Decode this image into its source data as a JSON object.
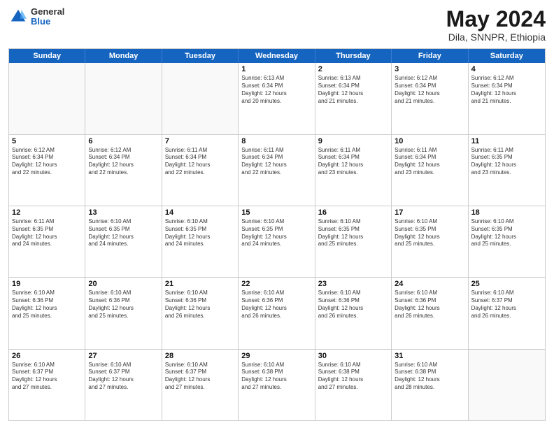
{
  "header": {
    "logo_line1": "General",
    "logo_line2": "Blue",
    "title": "May 2024",
    "subtitle": "Dila, SNNPR, Ethiopia"
  },
  "days_of_week": [
    "Sunday",
    "Monday",
    "Tuesday",
    "Wednesday",
    "Thursday",
    "Friday",
    "Saturday"
  ],
  "weeks": [
    [
      {
        "day": "",
        "info": "",
        "empty": true
      },
      {
        "day": "",
        "info": "",
        "empty": true
      },
      {
        "day": "",
        "info": "",
        "empty": true
      },
      {
        "day": "1",
        "info": "Sunrise: 6:13 AM\nSunset: 6:34 PM\nDaylight: 12 hours\nand 20 minutes.",
        "empty": false
      },
      {
        "day": "2",
        "info": "Sunrise: 6:13 AM\nSunset: 6:34 PM\nDaylight: 12 hours\nand 21 minutes.",
        "empty": false
      },
      {
        "day": "3",
        "info": "Sunrise: 6:12 AM\nSunset: 6:34 PM\nDaylight: 12 hours\nand 21 minutes.",
        "empty": false
      },
      {
        "day": "4",
        "info": "Sunrise: 6:12 AM\nSunset: 6:34 PM\nDaylight: 12 hours\nand 21 minutes.",
        "empty": false
      }
    ],
    [
      {
        "day": "5",
        "info": "Sunrise: 6:12 AM\nSunset: 6:34 PM\nDaylight: 12 hours\nand 22 minutes.",
        "empty": false
      },
      {
        "day": "6",
        "info": "Sunrise: 6:12 AM\nSunset: 6:34 PM\nDaylight: 12 hours\nand 22 minutes.",
        "empty": false
      },
      {
        "day": "7",
        "info": "Sunrise: 6:11 AM\nSunset: 6:34 PM\nDaylight: 12 hours\nand 22 minutes.",
        "empty": false
      },
      {
        "day": "8",
        "info": "Sunrise: 6:11 AM\nSunset: 6:34 PM\nDaylight: 12 hours\nand 22 minutes.",
        "empty": false
      },
      {
        "day": "9",
        "info": "Sunrise: 6:11 AM\nSunset: 6:34 PM\nDaylight: 12 hours\nand 23 minutes.",
        "empty": false
      },
      {
        "day": "10",
        "info": "Sunrise: 6:11 AM\nSunset: 6:34 PM\nDaylight: 12 hours\nand 23 minutes.",
        "empty": false
      },
      {
        "day": "11",
        "info": "Sunrise: 6:11 AM\nSunset: 6:35 PM\nDaylight: 12 hours\nand 23 minutes.",
        "empty": false
      }
    ],
    [
      {
        "day": "12",
        "info": "Sunrise: 6:11 AM\nSunset: 6:35 PM\nDaylight: 12 hours\nand 24 minutes.",
        "empty": false
      },
      {
        "day": "13",
        "info": "Sunrise: 6:10 AM\nSunset: 6:35 PM\nDaylight: 12 hours\nand 24 minutes.",
        "empty": false
      },
      {
        "day": "14",
        "info": "Sunrise: 6:10 AM\nSunset: 6:35 PM\nDaylight: 12 hours\nand 24 minutes.",
        "empty": false
      },
      {
        "day": "15",
        "info": "Sunrise: 6:10 AM\nSunset: 6:35 PM\nDaylight: 12 hours\nand 24 minutes.",
        "empty": false
      },
      {
        "day": "16",
        "info": "Sunrise: 6:10 AM\nSunset: 6:35 PM\nDaylight: 12 hours\nand 25 minutes.",
        "empty": false
      },
      {
        "day": "17",
        "info": "Sunrise: 6:10 AM\nSunset: 6:35 PM\nDaylight: 12 hours\nand 25 minutes.",
        "empty": false
      },
      {
        "day": "18",
        "info": "Sunrise: 6:10 AM\nSunset: 6:35 PM\nDaylight: 12 hours\nand 25 minutes.",
        "empty": false
      }
    ],
    [
      {
        "day": "19",
        "info": "Sunrise: 6:10 AM\nSunset: 6:36 PM\nDaylight: 12 hours\nand 25 minutes.",
        "empty": false
      },
      {
        "day": "20",
        "info": "Sunrise: 6:10 AM\nSunset: 6:36 PM\nDaylight: 12 hours\nand 25 minutes.",
        "empty": false
      },
      {
        "day": "21",
        "info": "Sunrise: 6:10 AM\nSunset: 6:36 PM\nDaylight: 12 hours\nand 26 minutes.",
        "empty": false
      },
      {
        "day": "22",
        "info": "Sunrise: 6:10 AM\nSunset: 6:36 PM\nDaylight: 12 hours\nand 26 minutes.",
        "empty": false
      },
      {
        "day": "23",
        "info": "Sunrise: 6:10 AM\nSunset: 6:36 PM\nDaylight: 12 hours\nand 26 minutes.",
        "empty": false
      },
      {
        "day": "24",
        "info": "Sunrise: 6:10 AM\nSunset: 6:36 PM\nDaylight: 12 hours\nand 26 minutes.",
        "empty": false
      },
      {
        "day": "25",
        "info": "Sunrise: 6:10 AM\nSunset: 6:37 PM\nDaylight: 12 hours\nand 26 minutes.",
        "empty": false
      }
    ],
    [
      {
        "day": "26",
        "info": "Sunrise: 6:10 AM\nSunset: 6:37 PM\nDaylight: 12 hours\nand 27 minutes.",
        "empty": false
      },
      {
        "day": "27",
        "info": "Sunrise: 6:10 AM\nSunset: 6:37 PM\nDaylight: 12 hours\nand 27 minutes.",
        "empty": false
      },
      {
        "day": "28",
        "info": "Sunrise: 6:10 AM\nSunset: 6:37 PM\nDaylight: 12 hours\nand 27 minutes.",
        "empty": false
      },
      {
        "day": "29",
        "info": "Sunrise: 6:10 AM\nSunset: 6:38 PM\nDaylight: 12 hours\nand 27 minutes.",
        "empty": false
      },
      {
        "day": "30",
        "info": "Sunrise: 6:10 AM\nSunset: 6:38 PM\nDaylight: 12 hours\nand 27 minutes.",
        "empty": false
      },
      {
        "day": "31",
        "info": "Sunrise: 6:10 AM\nSunset: 6:38 PM\nDaylight: 12 hours\nand 28 minutes.",
        "empty": false
      },
      {
        "day": "",
        "info": "",
        "empty": true
      }
    ]
  ]
}
